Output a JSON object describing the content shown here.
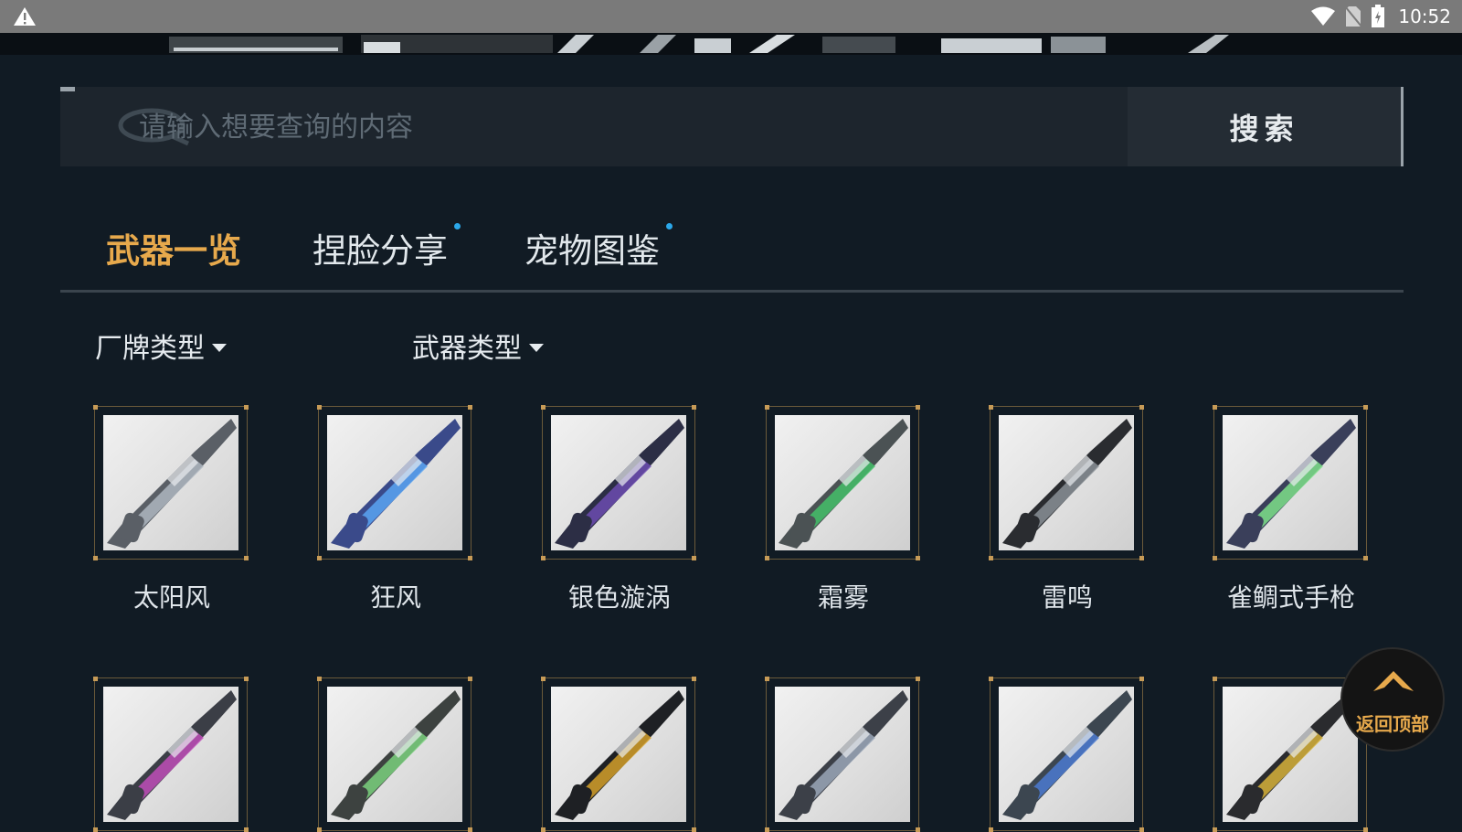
{
  "status_bar": {
    "time": "10:52",
    "icons": [
      "warning-icon",
      "wifi-icon",
      "no-sim-icon",
      "battery-icon"
    ]
  },
  "search": {
    "placeholder": "请输入想要查询的内容",
    "value": "",
    "button_label": "搜索"
  },
  "tabs": [
    {
      "label": "武器一览",
      "active": true,
      "has_dot": false
    },
    {
      "label": "捏脸分享",
      "active": false,
      "has_dot": true
    },
    {
      "label": "宠物图鉴",
      "active": false,
      "has_dot": true
    }
  ],
  "filters": [
    {
      "label": "厂牌类型"
    },
    {
      "label": "武器类型"
    }
  ],
  "weapons": [
    {
      "name": "太阳风"
    },
    {
      "name": "狂风"
    },
    {
      "name": "银色漩涡"
    },
    {
      "name": "霜雾"
    },
    {
      "name": "雷鸣"
    },
    {
      "name": "雀鲷式手枪"
    },
    {
      "name": ""
    },
    {
      "name": ""
    },
    {
      "name": ""
    },
    {
      "name": ""
    },
    {
      "name": ""
    },
    {
      "name": ""
    }
  ],
  "back_to_top": {
    "label": "返回顶部"
  },
  "colors": {
    "background": "#111b24",
    "accent": "#e7a94c",
    "tab_dot": "#2ba8ea",
    "frame_corner": "#c79b57"
  }
}
